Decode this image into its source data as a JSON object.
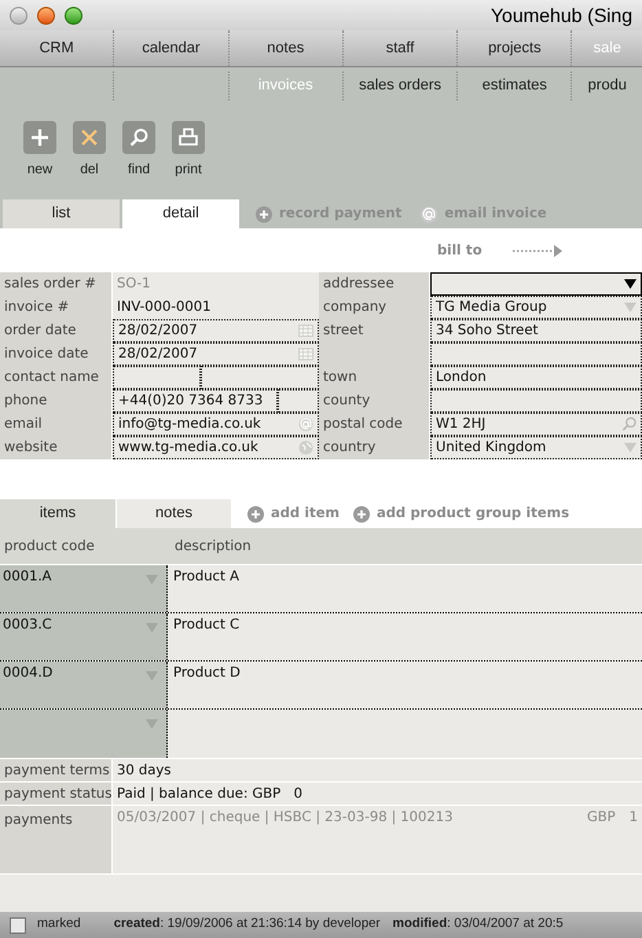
{
  "window": {
    "title": "Youmehub (Sing"
  },
  "nav": {
    "items": [
      {
        "label": "CRM",
        "selected": false
      },
      {
        "label": "calendar",
        "selected": false
      },
      {
        "label": "notes",
        "selected": false
      },
      {
        "label": "staff",
        "selected": false
      },
      {
        "label": "projects",
        "selected": false
      },
      {
        "label": "sale",
        "selected": true
      }
    ]
  },
  "subnav": {
    "items": [
      {
        "label": "invoices",
        "selected": true
      },
      {
        "label": "sales orders",
        "selected": false
      },
      {
        "label": "estimates",
        "selected": false
      },
      {
        "label": "produ",
        "selected": false
      }
    ]
  },
  "toolbar": {
    "buttons": [
      {
        "label": "new",
        "kind": "new"
      },
      {
        "label": "del",
        "kind": "del"
      },
      {
        "label": "find",
        "kind": "find"
      },
      {
        "label": "print",
        "kind": "print"
      }
    ]
  },
  "view_tabs": [
    {
      "label": "list",
      "selected": false
    },
    {
      "label": "detail",
      "selected": true
    }
  ],
  "actions": [
    {
      "label": "record payment",
      "kind": "plus"
    },
    {
      "label": "email invoice",
      "kind": "at"
    }
  ],
  "bill_to": {
    "label": "bill to"
  },
  "form": {
    "left": [
      {
        "label": "sales order #",
        "value": "SO-1",
        "kind": "readonly"
      },
      {
        "label": "invoice #",
        "value": "INV-000-0001",
        "kind": "plain"
      },
      {
        "label": "order date",
        "value": "28/02/2007",
        "kind": "date"
      },
      {
        "label": "invoice date",
        "value": "28/02/2007",
        "kind": "date"
      },
      {
        "label": "contact name",
        "kind": "split"
      },
      {
        "label": "phone",
        "value": "+44(0)20 7364 8733",
        "kind": "split"
      },
      {
        "label": "email",
        "value": "info@tg-media.co.uk",
        "kind": "email"
      },
      {
        "label": "website",
        "value": "www.tg-media.co.uk",
        "kind": "web"
      }
    ],
    "right": [
      {
        "label": "addressee",
        "kind": "combo"
      },
      {
        "label": "company",
        "value": "TG Media Group",
        "kind": "select"
      },
      {
        "label": "street",
        "value": "34 Soho Street",
        "kind": "text"
      },
      {
        "kind": "text"
      },
      {
        "label": "town",
        "value": "London",
        "kind": "text"
      },
      {
        "label": "county",
        "kind": "text"
      },
      {
        "label": "postal code",
        "value": "W1 2HJ",
        "kind": "search"
      },
      {
        "label": "country",
        "value": "United Kingdom",
        "kind": "select"
      }
    ]
  },
  "item_tabs": [
    {
      "label": "items",
      "selected": true
    },
    {
      "label": "notes",
      "selected": false
    }
  ],
  "item_actions": [
    {
      "label": "add item"
    },
    {
      "label": "add product group items"
    }
  ],
  "items": {
    "columns": [
      "product code",
      "description"
    ],
    "rows": [
      {
        "product_code": "0001.A",
        "description": "Product A"
      },
      {
        "product_code": "0003.C",
        "description": "Product C"
      },
      {
        "product_code": "0004.D",
        "description": "Product D"
      }
    ]
  },
  "payment": {
    "terms_label": "payment terms",
    "terms": "30 days",
    "status_label": "payment status",
    "status": "Paid | balance due: GBP   0",
    "payments_label": "payments",
    "entries": [
      {
        "text": "05/03/2007 | cheque | HSBC | 23-03-98 | 100213",
        "currency": "GBP",
        "amount": "1"
      }
    ]
  },
  "footer": {
    "marked": {
      "label": "marked",
      "checked": false
    },
    "created": "**created**: 19/09/2006 at 21:36:14 by developer",
    "modified": "**modified**: 03/04/2007 at 20:5"
  }
}
